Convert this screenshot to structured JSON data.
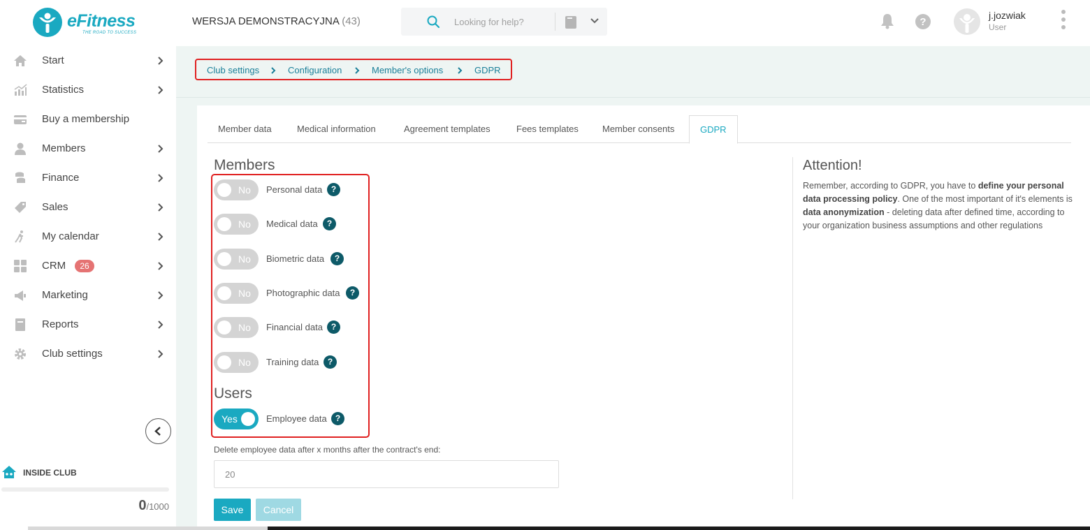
{
  "header": {
    "logo_text": "eFitness",
    "logo_tagline": "THE ROAD TO SUCCESS",
    "demo_label": "WERSJA DEMONSTRACYJNA",
    "demo_count": "(43)",
    "search_placeholder": "Looking for help?",
    "user_name": "j.jozwiak",
    "user_role": "User"
  },
  "sidebar": {
    "items": [
      {
        "label": "Start",
        "icon": "home-icon"
      },
      {
        "label": "Statistics",
        "icon": "chart-icon"
      },
      {
        "label": "Buy a membership",
        "icon": "card-icon"
      },
      {
        "label": "Members",
        "icon": "person-icon"
      },
      {
        "label": "Finance",
        "icon": "coins-icon"
      },
      {
        "label": "Sales",
        "icon": "tag-icon"
      },
      {
        "label": "My calendar",
        "icon": "runner-icon"
      },
      {
        "label": "CRM",
        "icon": "grid-icon",
        "badge": "26"
      },
      {
        "label": "Marketing",
        "icon": "megaphone-icon"
      },
      {
        "label": "Reports",
        "icon": "report-icon"
      },
      {
        "label": "Club settings",
        "icon": "gear-icon"
      }
    ],
    "inside_club_label": "INSIDE CLUB",
    "inside_count": "0",
    "inside_max": "/1000"
  },
  "breadcrumb": [
    "Club settings",
    "Configuration",
    "Member's options",
    "GDPR"
  ],
  "tabs": [
    "Member data",
    "Medical information",
    "Agreement templates",
    "Fees templates",
    "Member consents",
    "GDPR"
  ],
  "active_tab": "GDPR",
  "members_section": {
    "title": "Members",
    "toggles": [
      {
        "label": "Personal data",
        "state": "No"
      },
      {
        "label": "Medical data",
        "state": "No"
      },
      {
        "label": "Biometric data",
        "state": "No"
      },
      {
        "label": "Photographic data",
        "state": "No"
      },
      {
        "label": "Financial data",
        "state": "No"
      },
      {
        "label": "Training data",
        "state": "No"
      }
    ]
  },
  "users_section": {
    "title": "Users",
    "toggles": [
      {
        "label": "Employee data",
        "state": "Yes"
      }
    ]
  },
  "help_glyph": "?",
  "delete_field": {
    "label": "Delete employee data after x months after the contract's end:",
    "value": "20"
  },
  "buttons": {
    "save": "Save",
    "cancel": "Cancel"
  },
  "attention": {
    "title": "Attention!",
    "text_1": "Remember, according to GDPR, you have to ",
    "bold_1": "define your personal data processing policy",
    "text_2": ". One of the most important of it's elements is ",
    "bold_2": "data anonymization",
    "text_3": " - deleting data after defined time, according to your organization business assumptions and other regulations"
  },
  "colors": {
    "accent": "#1aa9c1",
    "help": "#0d5a68",
    "highlight": "#e02020",
    "badge": "#e57373"
  }
}
